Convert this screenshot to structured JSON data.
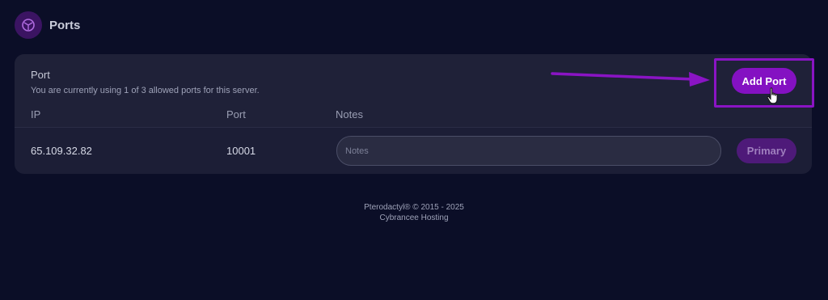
{
  "header": {
    "icon": "network-icon",
    "title": "Ports"
  },
  "ports_card": {
    "title": "Port",
    "subtitle": "You are currently using 1 of 3 allowed ports for this server.",
    "add_button_label": "Add Port",
    "columns": {
      "ip": "IP",
      "port": "Port",
      "notes": "Notes"
    },
    "rows": [
      {
        "ip": "65.109.32.82",
        "port": "10001",
        "notes_value": "",
        "notes_placeholder": "Notes",
        "primary_label": "Primary"
      }
    ]
  },
  "annotation": {
    "color": "#8a14c4",
    "arrow": "arrow-pointing-right",
    "cursor": "hand-pointer-icon"
  },
  "footer": {
    "copyright": "Pterodactyl® © 2015 - 2025",
    "host": "Cybrancee Hosting"
  },
  "colors": {
    "background": "#0b0e27",
    "card": "#1c1e36",
    "accent": "#8411c2",
    "primary_disabled": "#4e1a79"
  }
}
